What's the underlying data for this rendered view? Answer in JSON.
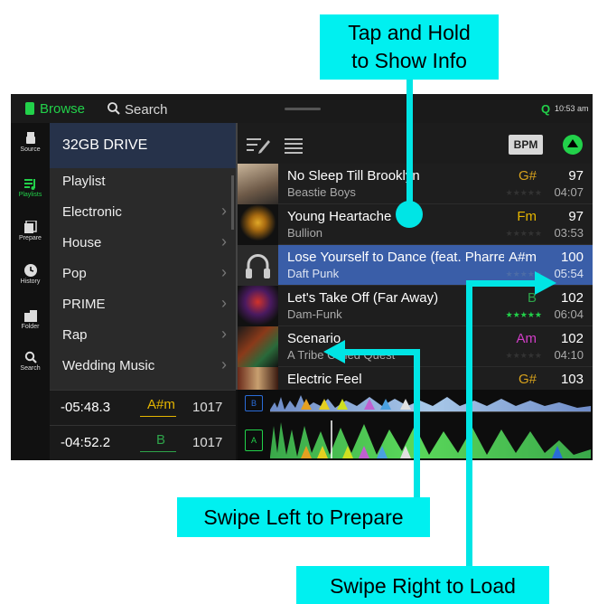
{
  "callouts": {
    "tap_hold": [
      "Tap and Hold",
      "to Show Info"
    ],
    "swipe_left": "Swipe Left to Prepare",
    "swipe_right": "Swipe Right to Load"
  },
  "colors": {
    "callout": "#00f0f0",
    "accent_green": "#22d14a",
    "selected_row": "#3a5ea8",
    "key_gold": "#d8a21c",
    "key_magenta": "#d23ec8"
  },
  "topbar": {
    "browse_label": "Browse",
    "search_label": "Search",
    "quantize": "Q",
    "clock": "10:53 am"
  },
  "nav": [
    {
      "label": "Source",
      "icon": "usb-icon"
    },
    {
      "label": "Playlists",
      "icon": "playlist-icon",
      "active": true
    },
    {
      "label": "Prepare",
      "icon": "prepare-icon"
    },
    {
      "label": "History",
      "icon": "history-icon"
    },
    {
      "label": "Folder",
      "icon": "folder-icon"
    },
    {
      "label": "Search",
      "icon": "search-icon"
    }
  ],
  "drive": {
    "title": "32GB DRIVE",
    "crates": [
      "Playlist",
      "Electronic",
      "House",
      "Pop",
      "PRIME",
      "Rap",
      "Wedding Music"
    ]
  },
  "toolbar": {
    "sort_label": "BPM"
  },
  "tracks": [
    {
      "title": "No Sleep Till Brooklyn",
      "artist": "Beastie Boys",
      "key": "G#",
      "bpm": "97",
      "length": "04:07"
    },
    {
      "title": "Young Heartache",
      "artist": "Bullion",
      "key": "Fm",
      "bpm": "97",
      "length": "03:53"
    },
    {
      "title": "Lose Yourself to Dance (feat. Pharrell",
      "artist": "Daft Punk",
      "key": "A#m",
      "bpm": "100",
      "length": "05:54"
    },
    {
      "title": "Let's Take Off (Far Away)",
      "artist": "Dam-Funk",
      "key": "B",
      "bpm": "102",
      "length": "06:04"
    },
    {
      "title": "Scenario",
      "artist": "A Tribe Called Quest",
      "key": "Am",
      "bpm": "102",
      "length": "04:10"
    },
    {
      "title": "Electric Feel",
      "artist": "",
      "key": "G#",
      "bpm": "103",
      "length": ""
    }
  ],
  "decks": [
    {
      "time": "-05:48.3",
      "key": "A#m",
      "bpm": "1017",
      "label": "B"
    },
    {
      "time": "-04:52.2",
      "key": "B",
      "bpm": "1017",
      "label": "A"
    }
  ]
}
